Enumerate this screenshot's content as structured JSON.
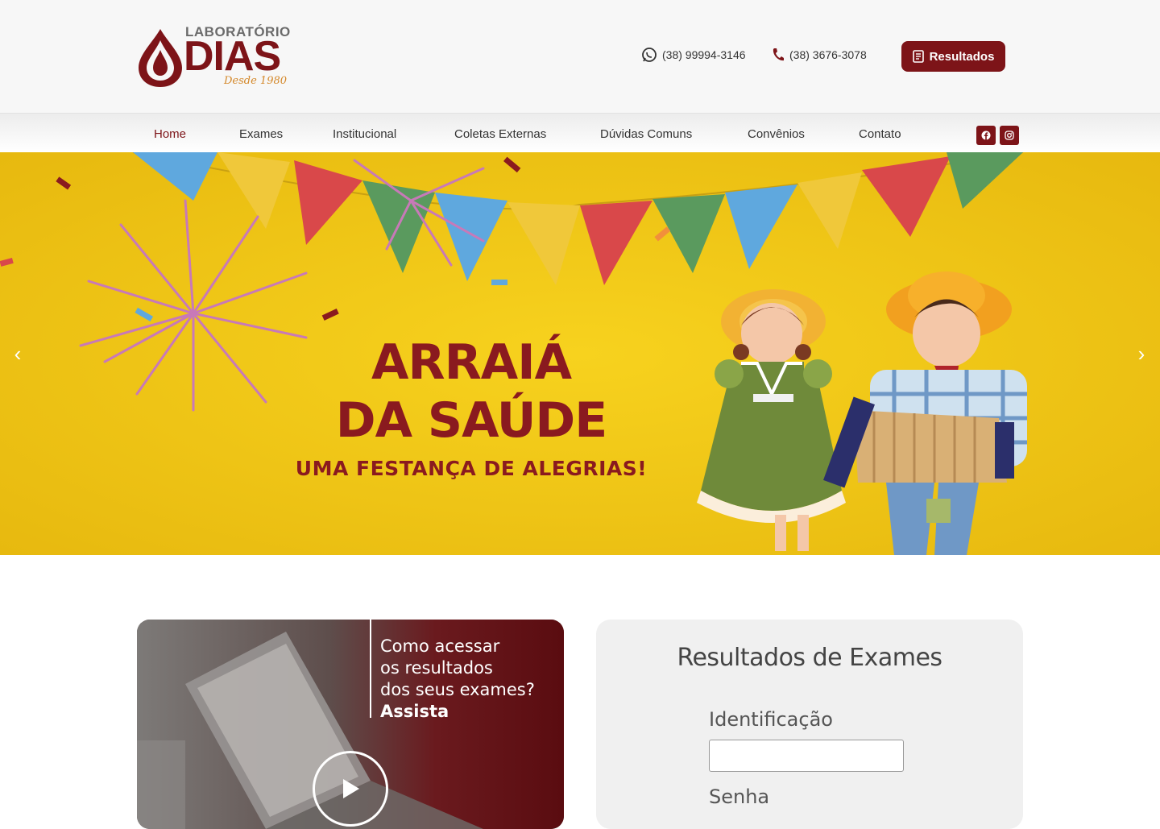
{
  "brand": {
    "lab_label": "LABORATÓRIO",
    "name": "DIAS",
    "since": "Desde 1980",
    "color": "#7d1418",
    "accent": "#d4882a"
  },
  "contacts": {
    "whatsapp": "(38) 99994-3146",
    "phone": "(38) 3676-3078"
  },
  "header": {
    "results_button": "Resultados"
  },
  "nav": {
    "items": [
      "Home",
      "Exames",
      "Institucional",
      "Coletas Externas",
      "Dúvidas Comuns",
      "Convênios",
      "Contato"
    ],
    "active": "Home",
    "social": [
      "facebook-icon",
      "instagram-icon"
    ]
  },
  "hero": {
    "title_line1": "ARRAIÁ",
    "title_line2": "DA SAÚDE",
    "subtitle": "UMA FESTANÇA DE ALEGRIAS!",
    "prev_arrow": "‹",
    "next_arrow": "›"
  },
  "video": {
    "line1": "Como acessar",
    "line2": "os resultados",
    "line3": "dos seus exames?",
    "cta": "Assista"
  },
  "results_form": {
    "title": "Resultados de Exames",
    "id_label": "Identificação",
    "id_value": "",
    "password_label": "Senha"
  }
}
